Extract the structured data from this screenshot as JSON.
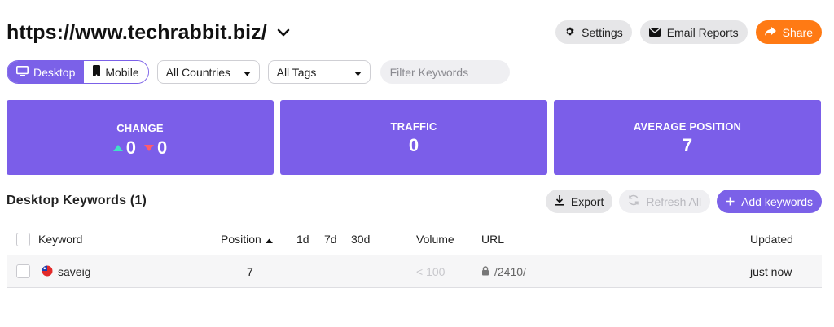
{
  "site": {
    "title": "https://www.techrabbit.biz/"
  },
  "top_actions": {
    "settings": "Settings",
    "email_reports": "Email Reports",
    "share": "Share"
  },
  "filters": {
    "device_desktop": "Desktop",
    "device_mobile": "Mobile",
    "countries": "All Countries",
    "tags": "All Tags",
    "search_placeholder": "Filter Keywords"
  },
  "stats": {
    "change_label": "CHANGE",
    "change_up": "0",
    "change_down": "0",
    "traffic_label": "TRAFFIC",
    "traffic_value": "0",
    "avg_label": "AVERAGE POSITION",
    "avg_value": "7"
  },
  "keywords": {
    "section_title": "Desktop Keywords (1)",
    "export": "Export",
    "refresh_all": "Refresh All",
    "add_keywords": "Add keywords",
    "columns": {
      "keyword": "Keyword",
      "position": "Position",
      "d1": "1d",
      "d7": "7d",
      "d30": "30d",
      "volume": "Volume",
      "url": "URL",
      "updated": "Updated"
    },
    "rows": [
      {
        "keyword": "saveig",
        "position": "7",
        "d1": "–",
        "d7": "–",
        "d30": "–",
        "volume": "< 100",
        "url": "/2410/",
        "updated": "just now"
      }
    ]
  },
  "colors": {
    "accent": "#7b61e8",
    "card": "#7b5ee9",
    "share": "#ff7a14",
    "up": "#3fe1c6",
    "down": "#ff5c6c"
  },
  "icons": [
    "chevron-down-icon",
    "gear-icon",
    "envelope-icon",
    "share-arrow-icon",
    "desktop-icon",
    "mobile-icon",
    "dropdown-caret-icon",
    "triangle-up-icon",
    "triangle-down-icon",
    "download-icon",
    "refresh-icon",
    "plus-icon",
    "sort-up-icon",
    "flag-icon",
    "lock-icon"
  ]
}
